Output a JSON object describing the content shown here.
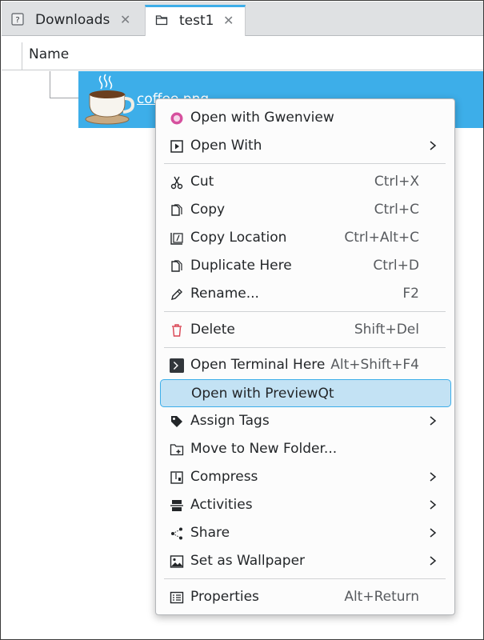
{
  "tabs": [
    {
      "label": "Downloads",
      "icon": "unknown-file-icon",
      "close": "✕"
    },
    {
      "label": "test1",
      "icon": "folder-icon",
      "close": "✕"
    }
  ],
  "column_header": {
    "name": "Name"
  },
  "file": {
    "name": "coffee.png",
    "icon": "coffee-cup-icon"
  },
  "menu": {
    "open_gwenview": {
      "label": "Open with Gwenview"
    },
    "open_with": {
      "label": "Open With"
    },
    "cut": {
      "label": "Cut",
      "shortcut": "Ctrl+X"
    },
    "copy": {
      "label": "Copy",
      "shortcut": "Ctrl+C"
    },
    "copy_location": {
      "label": "Copy Location",
      "shortcut": "Ctrl+Alt+C"
    },
    "duplicate": {
      "label": "Duplicate Here",
      "shortcut": "Ctrl+D"
    },
    "rename": {
      "label": "Rename...",
      "shortcut": "F2"
    },
    "delete": {
      "label": "Delete",
      "shortcut": "Shift+Del"
    },
    "terminal": {
      "label": "Open Terminal Here",
      "shortcut": "Alt+Shift+F4"
    },
    "previewqt": {
      "label": "Open with PreviewQt"
    },
    "tags": {
      "label": "Assign Tags"
    },
    "move_folder": {
      "label": "Move to New Folder..."
    },
    "compress": {
      "label": "Compress"
    },
    "activities": {
      "label": "Activities"
    },
    "share": {
      "label": "Share"
    },
    "wallpaper": {
      "label": "Set as Wallpaper"
    },
    "properties": {
      "label": "Properties",
      "shortcut": "Alt+Return"
    }
  },
  "colors": {
    "accent": "#3daee9",
    "highlight": "#c3e2f4",
    "delete_red": "#da4453"
  }
}
